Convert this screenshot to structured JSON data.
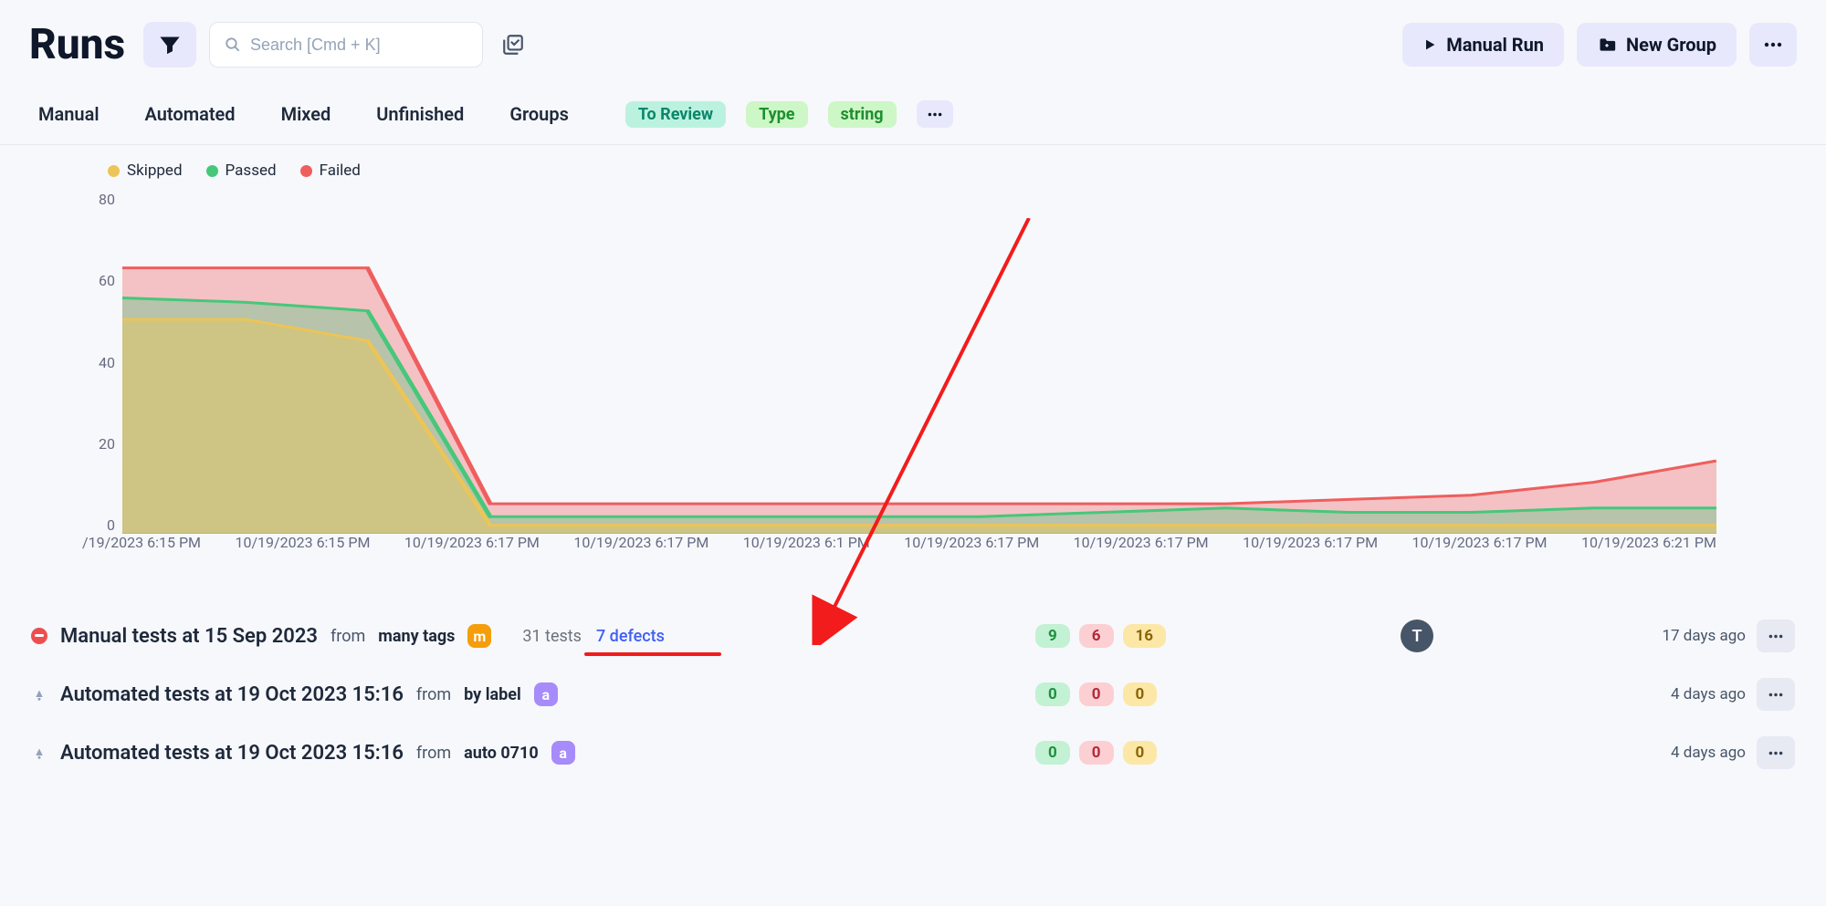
{
  "header": {
    "title": "Runs",
    "search_placeholder": "Search [Cmd + K]",
    "manual_run_label": "Manual Run",
    "new_group_label": "New Group"
  },
  "tabs": [
    "Manual",
    "Automated",
    "Mixed",
    "Unfinished",
    "Groups"
  ],
  "filters": {
    "pill1": "To Review",
    "pill2": "Type",
    "pill3": "string"
  },
  "chart_data": {
    "type": "area",
    "title": "",
    "ylabel": "",
    "xlabel": "",
    "ylim": [
      0,
      80
    ],
    "x_ticks": [
      "/19/2023 6:15 PM",
      "10/19/2023 6:15 PM",
      "10/19/2023 6:17 PM",
      "10/19/2023 6:17 PM",
      "10/19/2023 6:17 PM",
      "10/19/2023 6:17 PM",
      "10/19/2023 6:17 PM",
      "10/19/2023 6:17 PM",
      "10/19/2023 6:17 PM",
      "10/19/2023 6:21 PM"
    ],
    "y_ticks": [
      80,
      60,
      40,
      20,
      0
    ],
    "legend": [
      {
        "name": "Skipped",
        "color": "#ebc557"
      },
      {
        "name": "Passed",
        "color": "#46c77a"
      },
      {
        "name": "Failed",
        "color": "#ef5e5e"
      }
    ],
    "series": [
      {
        "name": "Skipped",
        "color": "#ebc557",
        "values": [
          50,
          50,
          45,
          2,
          2,
          2,
          2,
          2,
          2,
          2,
          2,
          2,
          2,
          2
        ]
      },
      {
        "name": "Passed",
        "color": "#46c77a",
        "values": [
          55,
          54,
          52,
          4,
          4,
          4,
          4,
          4,
          5,
          6,
          5,
          5,
          6,
          6
        ]
      },
      {
        "name": "Failed",
        "color": "#ef5e5e",
        "values": [
          62,
          62,
          62,
          7,
          7,
          7,
          7,
          7,
          7,
          7,
          8,
          9,
          12,
          17
        ]
      }
    ]
  },
  "runs": [
    {
      "status": "failed",
      "title": "Manual tests at 15 Sep 2023",
      "from_prefix": "from",
      "from_value": "many tags",
      "tag_letter": "m",
      "tag_class": "tag-orange",
      "tests": "31 tests",
      "defects": "7 defects",
      "counts": {
        "passed": "9",
        "failed": "6",
        "skipped": "16"
      },
      "avatar_letter": "T",
      "time_ago": "17 days ago"
    },
    {
      "status": "auto",
      "title": "Automated tests at 19 Oct 2023 15:16",
      "from_prefix": "from",
      "from_value": "by label",
      "tag_letter": "a",
      "tag_class": "tag-purple",
      "tests": "",
      "defects": "",
      "counts": {
        "passed": "0",
        "failed": "0",
        "skipped": "0"
      },
      "avatar_letter": "",
      "time_ago": "4 days ago"
    },
    {
      "status": "auto",
      "title": "Automated tests at 19 Oct 2023 15:16",
      "from_prefix": "from",
      "from_value": "auto 0710",
      "tag_letter": "a",
      "tag_class": "tag-purple",
      "tests": "",
      "defects": "",
      "counts": {
        "passed": "0",
        "failed": "0",
        "skipped": "0"
      },
      "avatar_letter": "",
      "time_ago": "4 days ago"
    }
  ]
}
